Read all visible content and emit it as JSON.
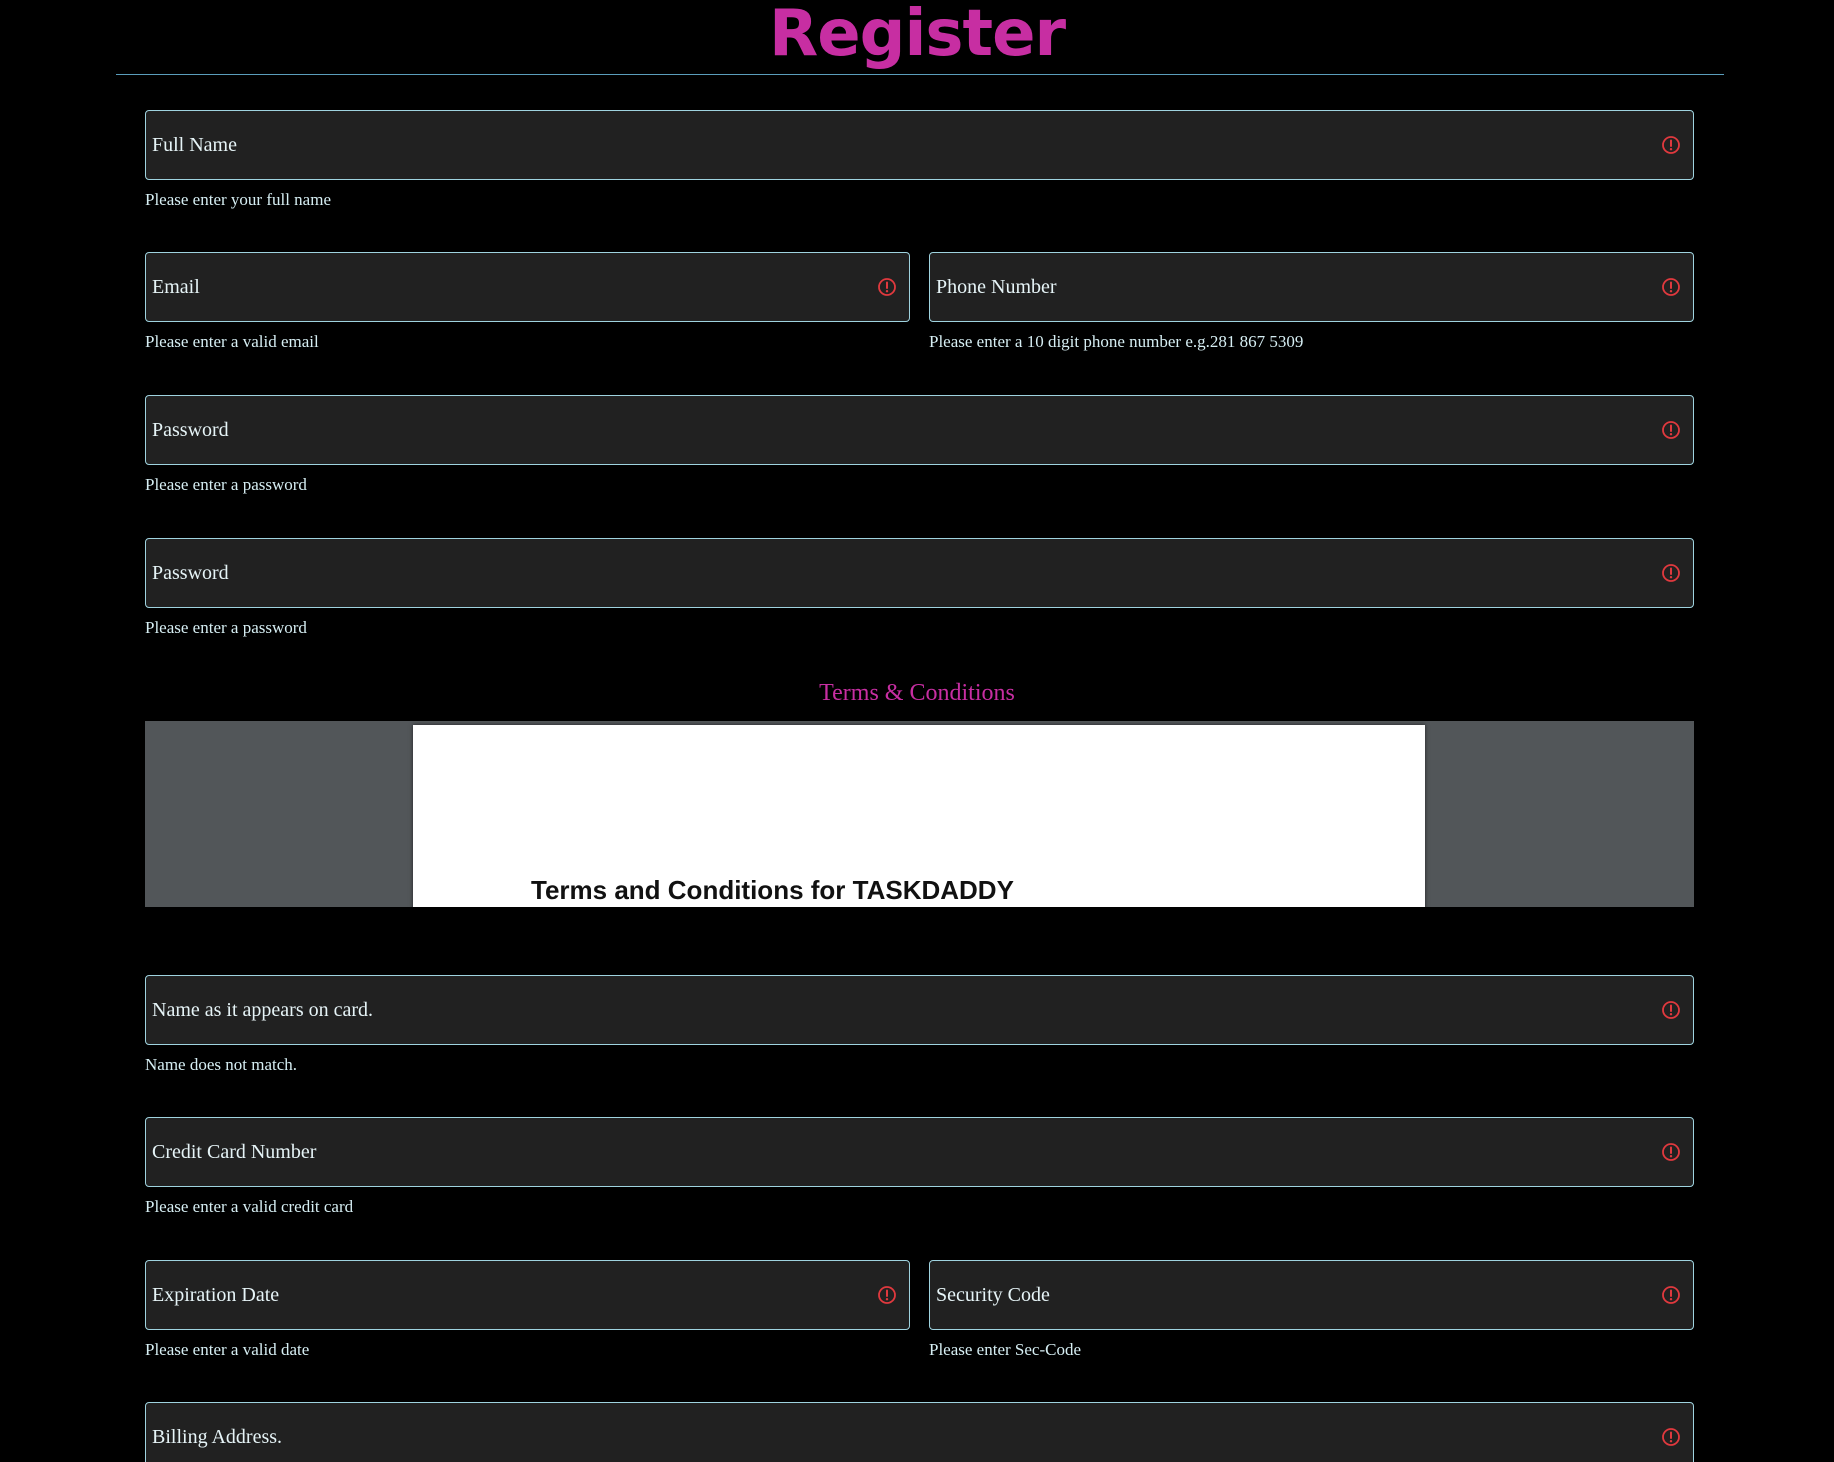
{
  "page": {
    "title": "Register"
  },
  "fields": {
    "full_name": {
      "placeholder": "Full Name",
      "hint": "Please enter your full name"
    },
    "email": {
      "placeholder": "Email",
      "hint": "Please enter a valid email"
    },
    "phone": {
      "placeholder": "Phone Number",
      "hint": "Please enter a 10 digit phone number e.g.281 867 5309"
    },
    "password": {
      "placeholder": "Password",
      "hint": "Please enter a password"
    },
    "password_confirm": {
      "placeholder": "Password",
      "hint": "Please enter a password"
    },
    "card_name": {
      "placeholder": "Name as it appears on card.",
      "hint": "Name does not match."
    },
    "card_number": {
      "placeholder": "Credit Card Number",
      "hint": "Please enter a valid credit card"
    },
    "expiration": {
      "placeholder": "Expiration Date",
      "hint": "Please enter a valid date"
    },
    "security_code": {
      "placeholder": "Security Code",
      "hint": "Please enter Sec-Code"
    },
    "billing_address": {
      "placeholder": "Billing Address."
    }
  },
  "terms": {
    "section_title": "Terms & Conditions",
    "document_heading": "Terms and Conditions for TASKDADDY"
  },
  "icons": {
    "error": "error-circle-icon"
  },
  "colors": {
    "accent": "#c72ea2",
    "field_border": "#9fd3df",
    "error": "#e0393e",
    "background": "#000000"
  }
}
